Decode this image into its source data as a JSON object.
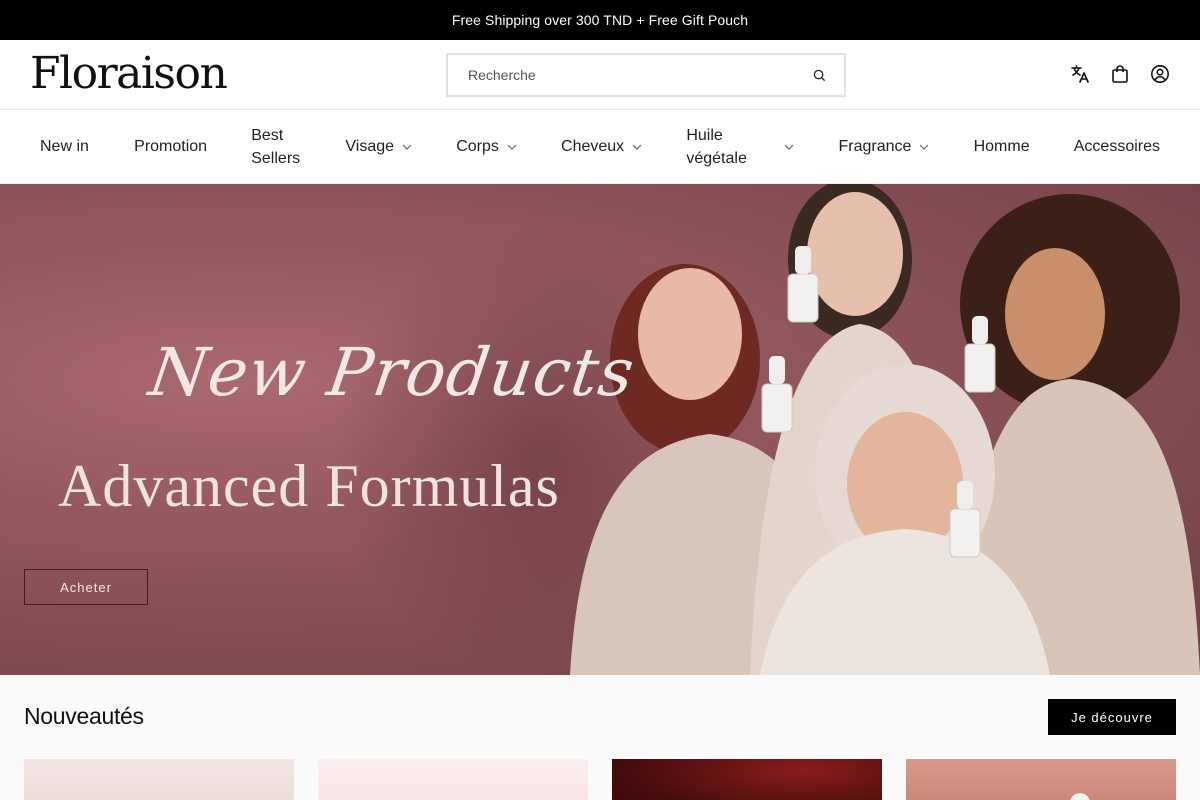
{
  "announcement": "Free Shipping over 300 TND + Free Gift Pouch",
  "header": {
    "logo": "Floraison",
    "search_placeholder": "Recherche",
    "icons": [
      "translate-icon",
      "shopping-bag-icon",
      "account-icon"
    ]
  },
  "nav": {
    "items": [
      {
        "label": "New in",
        "has_dropdown": false
      },
      {
        "label": "Promotion",
        "has_dropdown": false
      },
      {
        "label": "Best Sellers",
        "has_dropdown": false
      },
      {
        "label": "Visage",
        "has_dropdown": true
      },
      {
        "label": "Corps",
        "has_dropdown": true
      },
      {
        "label": "Cheveux",
        "has_dropdown": true
      },
      {
        "label": "Huile végétale",
        "has_dropdown": true
      },
      {
        "label": "Fragrance",
        "has_dropdown": true
      },
      {
        "label": "Homme",
        "has_dropdown": false
      },
      {
        "label": "Accessoires",
        "has_dropdown": false
      }
    ]
  },
  "hero": {
    "script_text": "New Products",
    "title": "Advanced Formulas",
    "button": "Acheter"
  },
  "section": {
    "title": "Nouveautés",
    "button": "Je découvre"
  },
  "colors": {
    "announcement_bg": "#000000",
    "hero_bg": "#93585e",
    "primary_button": "#000000"
  }
}
